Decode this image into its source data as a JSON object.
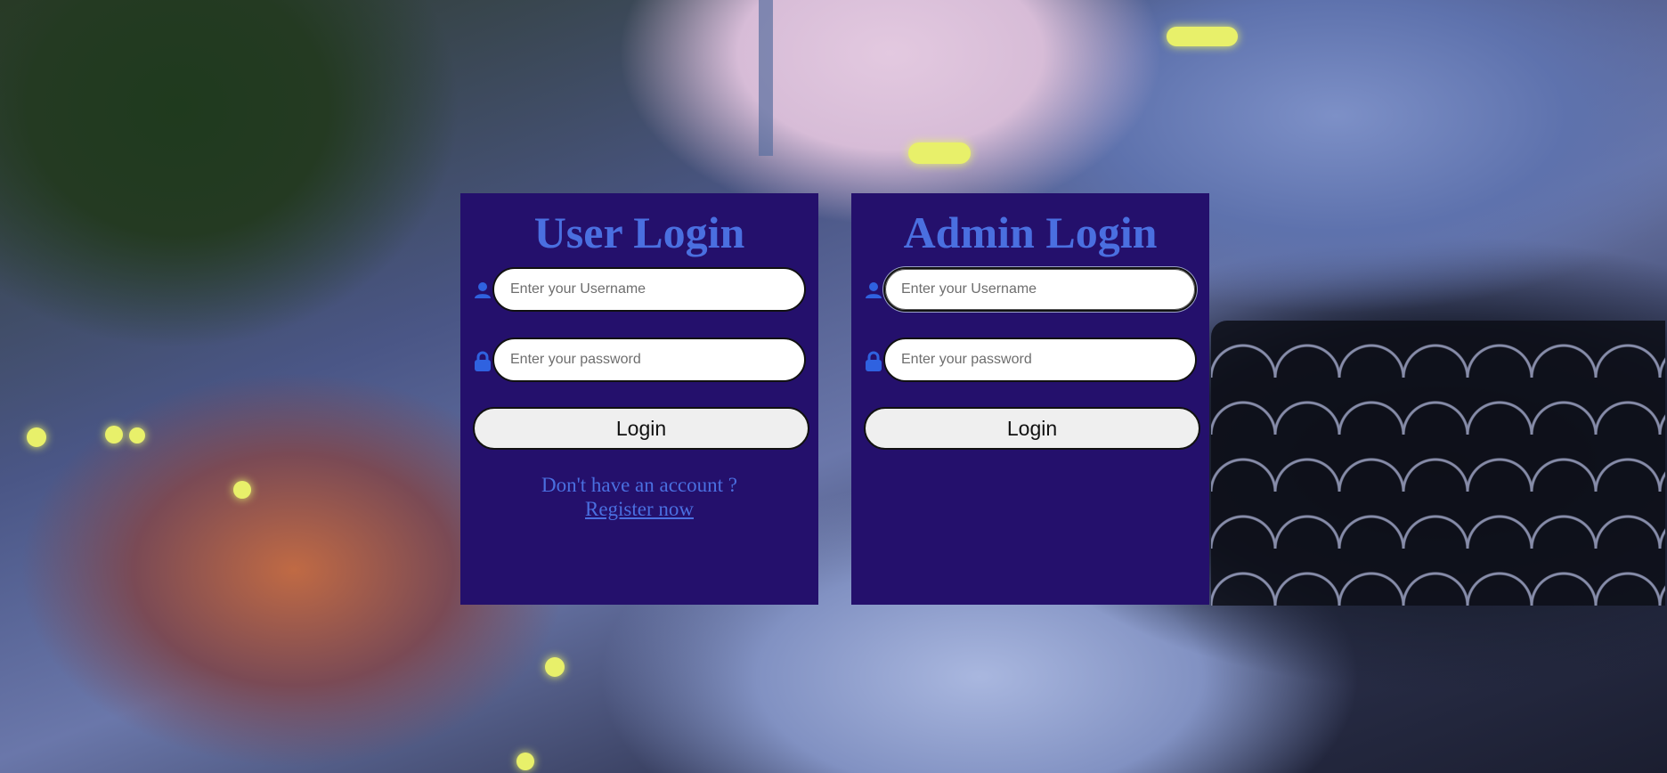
{
  "colors": {
    "panel_bg": "#24106c",
    "accent": "#4a6fe0",
    "input_bg": "#ffffff",
    "button_bg": "#efefef"
  },
  "user_login": {
    "title": "User Login",
    "username": {
      "value": "",
      "placeholder": "Enter your Username",
      "icon": "user-icon"
    },
    "password": {
      "value": "",
      "placeholder": "Enter your password",
      "icon": "lock-icon"
    },
    "login_label": "Login",
    "register_prompt": "Don't have an account ?",
    "register_link": "Register now"
  },
  "admin_login": {
    "title": "Admin Login",
    "username": {
      "value": "",
      "placeholder": "Enter your Username",
      "icon": "user-icon"
    },
    "password": {
      "value": "",
      "placeholder": "Enter your password",
      "icon": "lock-icon"
    },
    "login_label": "Login"
  }
}
